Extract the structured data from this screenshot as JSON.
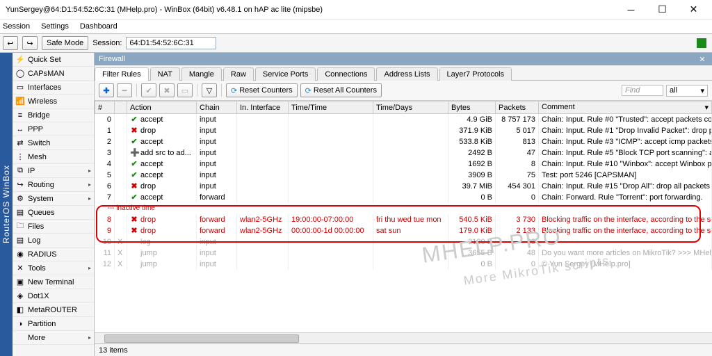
{
  "window": {
    "title": "YunSergey@64:D1:54:52:6C:31 (MHelp.pro) - WinBox (64bit) v6.48.1 on hAP ac lite (mipsbe)"
  },
  "menu": {
    "session": "Session",
    "settings": "Settings",
    "dashboard": "Dashboard"
  },
  "toolbar": {
    "safe_mode": "Safe Mode",
    "session_label": "Session:",
    "session_value": "64:D1:54:52:6C:31"
  },
  "side_title": "RouterOS WinBox",
  "sidenav": [
    {
      "icon": "⚡",
      "label": "Quick Set"
    },
    {
      "icon": "◯",
      "label": "CAPsMAN"
    },
    {
      "icon": "▭",
      "label": "Interfaces"
    },
    {
      "icon": "📶",
      "label": "Wireless"
    },
    {
      "icon": "≡",
      "label": "Bridge"
    },
    {
      "icon": "↔",
      "label": "PPP"
    },
    {
      "icon": "⇄",
      "label": "Switch"
    },
    {
      "icon": "⋮",
      "label": "Mesh"
    },
    {
      "icon": "⧉",
      "label": "IP",
      "sub": true
    },
    {
      "icon": "↪",
      "label": "Routing",
      "sub": true
    },
    {
      "icon": "⚙",
      "label": "System",
      "sub": true
    },
    {
      "icon": "▤",
      "label": "Queues"
    },
    {
      "icon": "🗀",
      "label": "Files"
    },
    {
      "icon": "▤",
      "label": "Log"
    },
    {
      "icon": "◉",
      "label": "RADIUS"
    },
    {
      "icon": "✕",
      "label": "Tools",
      "sub": true
    },
    {
      "icon": "▣",
      "label": "New Terminal"
    },
    {
      "icon": "◈",
      "label": "Dot1X"
    },
    {
      "icon": "◧",
      "label": "MetaROUTER"
    },
    {
      "icon": "◑",
      "label": "Partition"
    },
    {
      "icon": "",
      "label": "More",
      "sub": true
    }
  ],
  "panel": {
    "title": "Firewall"
  },
  "tabs": [
    "Filter Rules",
    "NAT",
    "Mangle",
    "Raw",
    "Service Ports",
    "Connections",
    "Address Lists",
    "Layer7 Protocols"
  ],
  "fbar": {
    "reset": "Reset Counters",
    "reset_all": "Reset All Counters",
    "find": "Find",
    "all": "all"
  },
  "cols": [
    "#",
    "",
    "Action",
    "Chain",
    "In. Interface",
    "Time/Time",
    "Time/Days",
    "Bytes",
    "Packets",
    "Comment"
  ],
  "sep_label": "--- inactive time",
  "rows": [
    {
      "n": "0",
      "aicon": "✔",
      "acls": "ok",
      "action": "accept",
      "chain": "input",
      "if": "",
      "tt": "",
      "td": "",
      "bytes": "4.9 GiB",
      "pkts": "8 757 173",
      "cmt": "Chain: Input. Rule #0 \"Trusted\": accept packets connectio"
    },
    {
      "n": "1",
      "aicon": "✖",
      "acls": "no",
      "action": "drop",
      "chain": "input",
      "if": "",
      "tt": "",
      "td": "",
      "bytes": "371.9 KiB",
      "pkts": "5 017",
      "cmt": "Chain: Input. Rule #1 \"Drop Invalid Packet\": drop packets"
    },
    {
      "n": "2",
      "aicon": "✔",
      "acls": "ok",
      "action": "accept",
      "chain": "input",
      "if": "",
      "tt": "",
      "td": "",
      "bytes": "533.8 KiB",
      "pkts": "813",
      "cmt": "Chain: Input. Rule #3 \"ICMP\": accept icmp packets."
    },
    {
      "n": "3",
      "aicon": "➕",
      "acls": "",
      "action": "add src to ad...",
      "chain": "input",
      "if": "",
      "tt": "",
      "td": "",
      "bytes": "2492 B",
      "pkts": "47",
      "cmt": "Chain: Input. Rule #5 \"Block TCP port scanning\": add a de"
    },
    {
      "n": "4",
      "aicon": "✔",
      "acls": "ok",
      "action": "accept",
      "chain": "input",
      "if": "",
      "tt": "",
      "td": "",
      "bytes": "1692 B",
      "pkts": "8",
      "cmt": "Chain: Input. Rule #10 \"Winbox\": accept Winbox port con."
    },
    {
      "n": "5",
      "aicon": "✔",
      "acls": "ok",
      "action": "accept",
      "chain": "input",
      "if": "",
      "tt": "",
      "td": "",
      "bytes": "3909 B",
      "pkts": "75",
      "cmt": "Test: port 5246 [CAPSMAN]"
    },
    {
      "n": "6",
      "aicon": "✖",
      "acls": "no",
      "action": "drop",
      "chain": "input",
      "if": "",
      "tt": "",
      "td": "",
      "bytes": "39.7 MiB",
      "pkts": "454 301",
      "cmt": "Chain: Input. Rule #15 \"Drop All\": drop all packets that do"
    },
    {
      "n": "7",
      "aicon": "✔",
      "acls": "ok",
      "action": "accept",
      "chain": "forward",
      "if": "",
      "tt": "",
      "td": "",
      "bytes": "0 B",
      "pkts": "0",
      "cmt": "Chain: Forward. Rule \"Torrent\": port forwarding."
    },
    {
      "sep": true
    },
    {
      "n": "8",
      "aicon": "✖",
      "acls": "no",
      "action": "drop",
      "chain": "forward",
      "if": "wlan2-5GHz",
      "tt": "19:00:00-07:00:00",
      "td": "fri thu wed tue mon",
      "bytes": "540.5 KiB",
      "pkts": "3 730",
      "cmt": "Blocking traffic on the interface, according to the schedule.",
      "cls": "red"
    },
    {
      "n": "9",
      "aicon": "✖",
      "acls": "no",
      "action": "drop",
      "chain": "forward",
      "if": "wlan2-5GHz",
      "tt": "00:00:00-1d 00:00:00",
      "td": "sat sun",
      "bytes": "179.0 KiB",
      "pkts": "2 133",
      "cmt": "Blocking traffic on the interface, according to the schedule.",
      "cls": "red"
    },
    {
      "n": "10",
      "flag": "X",
      "aicon": "",
      "acls": "",
      "action": "log",
      "chain": "input",
      "if": "",
      "tt": "",
      "td": "",
      "bytes": "3120 B",
      "pkts": "33",
      "cmt": "",
      "cls": "dim"
    },
    {
      "n": "11",
      "flag": "X",
      "aicon": "",
      "acls": "",
      "action": "jump",
      "chain": "input",
      "if": "",
      "tt": "",
      "td": "",
      "bytes": "3655 B",
      "pkts": "48",
      "cmt": "Do you want more articles on MikroTik? >>> MHelp.pro",
      "cls": "dim"
    },
    {
      "n": "12",
      "flag": "X",
      "aicon": "",
      "acls": "",
      "action": "jump",
      "chain": "input",
      "if": "",
      "tt": "",
      "td": "",
      "bytes": "0 B",
      "pkts": "0",
      "cmt": "© Yun Sergey [MHelp.pro]",
      "cls": "dim"
    }
  ],
  "status": "13 items",
  "watermark1": "MHELP.PRO",
  "watermark2": "More MikroTik scripts"
}
